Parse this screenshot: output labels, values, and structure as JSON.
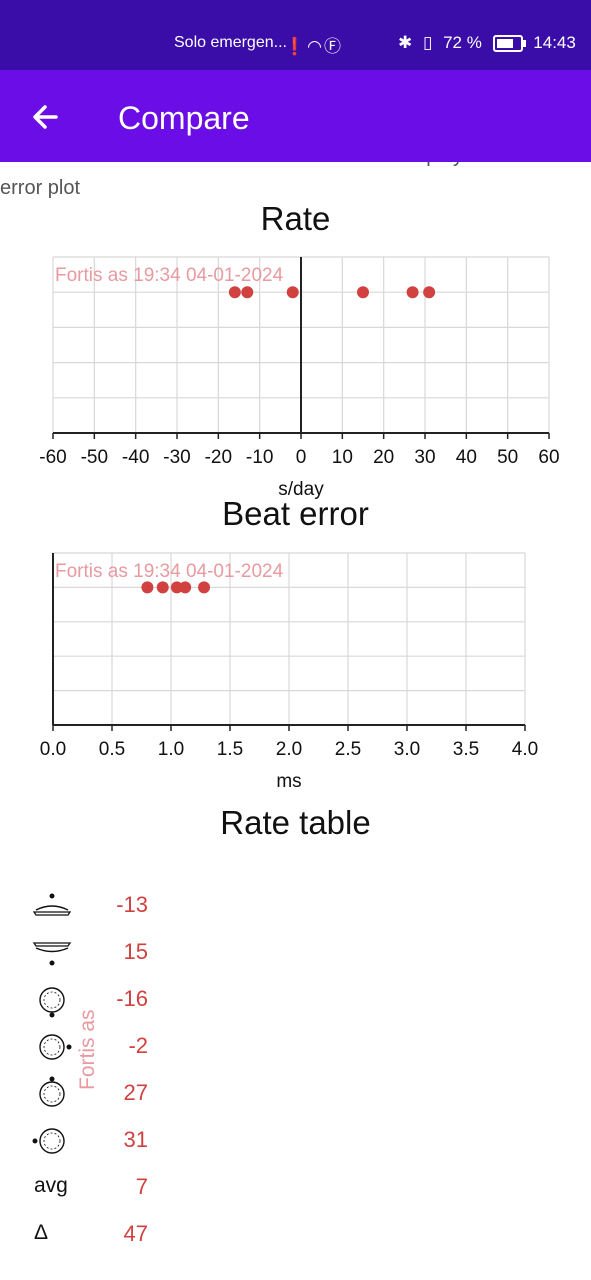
{
  "status_bar": {
    "carrier": "Solo emergen...",
    "battery": "72 %",
    "time": "14:43"
  },
  "app_bar": {
    "title": "Compare"
  },
  "note": "The results that don't have beat error are not displayed on the beat error plot",
  "colors": {
    "status_bar": "#3a0ca8",
    "app_bar": "#6a0de6",
    "series": "#d0413f",
    "series_label": "#e89aa0"
  },
  "chart_data": [
    {
      "type": "scatter",
      "title": "Rate",
      "xlabel": "s/day",
      "xlim": [
        -60,
        60
      ],
      "x_ticks": [
        "-60",
        "-50",
        "-40",
        "-30",
        "-20",
        "-10",
        "0",
        "10",
        "20",
        "30",
        "40",
        "50",
        "60"
      ],
      "series": [
        {
          "name": "Fortis as 19:34 04-01-2024",
          "x": [
            -16,
            -13,
            -2,
            15,
            27,
            31
          ]
        }
      ],
      "grid": true
    },
    {
      "type": "scatter",
      "title": "Beat error",
      "xlabel": "ms",
      "xlim": [
        0,
        4
      ],
      "x_ticks": [
        "0.0",
        "0.5",
        "1.0",
        "1.5",
        "2.0",
        "2.5",
        "3.0",
        "3.5",
        "4.0"
      ],
      "series": [
        {
          "name": "Fortis as 19:34 04-01-2024",
          "x": [
            0.8,
            0.93,
            1.05,
            1.12,
            1.28
          ]
        }
      ],
      "grid": true
    }
  ],
  "rate_table": {
    "title": "Rate table",
    "series_name": "Fortis as",
    "rows": [
      {
        "icon": "dial-up-icon",
        "value": "-13"
      },
      {
        "icon": "dial-down-icon",
        "value": "15"
      },
      {
        "icon": "crown-down-icon",
        "value": "-16"
      },
      {
        "icon": "crown-right-icon",
        "value": "-2"
      },
      {
        "icon": "crown-up-icon",
        "value": "27"
      },
      {
        "icon": "crown-left-icon",
        "value": "31"
      },
      {
        "label": "avg",
        "value": "7"
      },
      {
        "label": "Δ",
        "value": "47"
      }
    ]
  }
}
